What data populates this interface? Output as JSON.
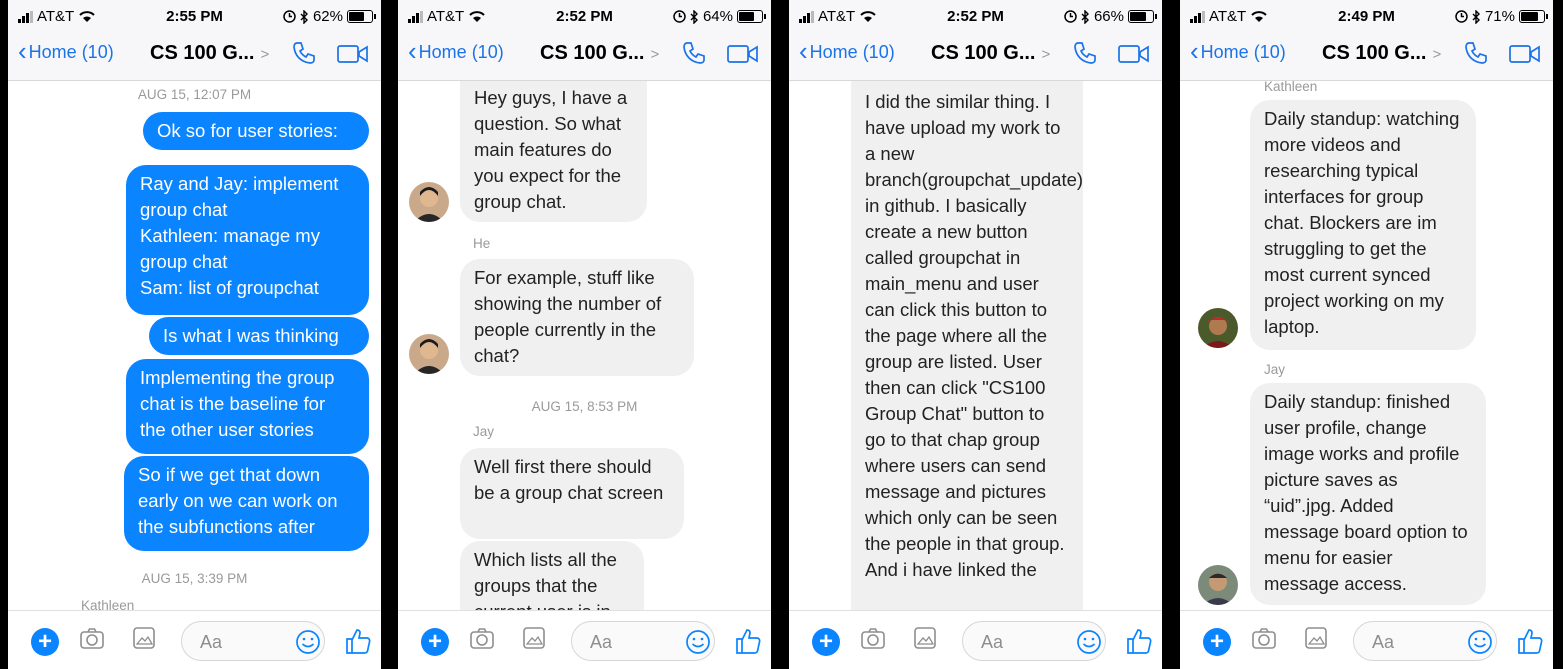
{
  "phones": [
    {
      "carrier": "AT&T",
      "time": "2:55 PM",
      "battery": "62%",
      "battery_level": 0.62,
      "back_label": "Home (10)",
      "title": "CS 100 G...",
      "stamps": [
        "AUG 15, 12:07 PM",
        "AUG 15, 3:39 PM"
      ],
      "senders": [
        "Kathleen"
      ],
      "messages": [
        "Ok so for user stories:",
        "Ray and Jay: implement group chat\nKathleen: manage my group chat\nSam: list of groupchat",
        "Is what I was thinking",
        "Implementing the group chat is the baseline for the other user stories",
        "So if we get that down early on we can work on the subfunctions after"
      ],
      "composer_placeholder": "Aa"
    },
    {
      "carrier": "AT&T",
      "time": "2:52 PM",
      "battery": "64%",
      "battery_level": 0.64,
      "back_label": "Home (10)",
      "title": "CS 100 G...",
      "stamps": [
        "AUG 15, 8:53 PM"
      ],
      "senders": [
        "He",
        "Jay"
      ],
      "messages": [
        "Hey guys, I have a question. So what main features do you expect for the group chat.",
        "For example, stuff like showing the number of people currently in the chat?",
        "Well first there should be a group chat screen",
        "Which lists all the groups that the current user is in"
      ],
      "composer_placeholder": "Aa"
    },
    {
      "carrier": "AT&T",
      "time": "2:52 PM",
      "battery": "66%",
      "battery_level": 0.66,
      "back_label": "Home (10)",
      "title": "CS 100 G...",
      "messages": [
        "I did the similar thing. I have upload my work to a new branch(groupchat_update) in github. I basically create a new button called groupchat in main_menu and user can click this button to the page where all the group are listed. User then can click \"CS100 Group Chat\" button to go to that chap group where users can send message and pictures which only can be seen the people in that group. And i have linked the"
      ],
      "composer_placeholder": "Aa"
    },
    {
      "carrier": "AT&T",
      "time": "2:49 PM",
      "battery": "71%",
      "battery_level": 0.71,
      "back_label": "Home (10)",
      "title": "CS 100 G...",
      "senders": [
        "Kathleen",
        "Jay"
      ],
      "messages": [
        "Daily standup: watching more videos and researching typical interfaces for group chat. Blockers are im struggling to get the most current synced project working on my laptop.",
        "Daily standup: finished user profile, change image works and profile picture saves as “uid”.jpg. Added message board option to menu for easier message access."
      ],
      "composer_placeholder": "Aa"
    }
  ],
  "colors": {
    "accent": "#0a84ff",
    "nav_blue": "#1a73e8",
    "incoming_bubble": "#f0f0f0",
    "background": "#000000"
  },
  "icons": [
    "signal-bars-icon",
    "wifi-icon",
    "alarm-icon",
    "bluetooth-icon",
    "battery-icon",
    "back-chevron-icon",
    "phone-icon",
    "video-camera-icon",
    "plus-icon",
    "camera-icon",
    "gallery-icon",
    "smiley-icon",
    "thumbs-up-icon"
  ]
}
